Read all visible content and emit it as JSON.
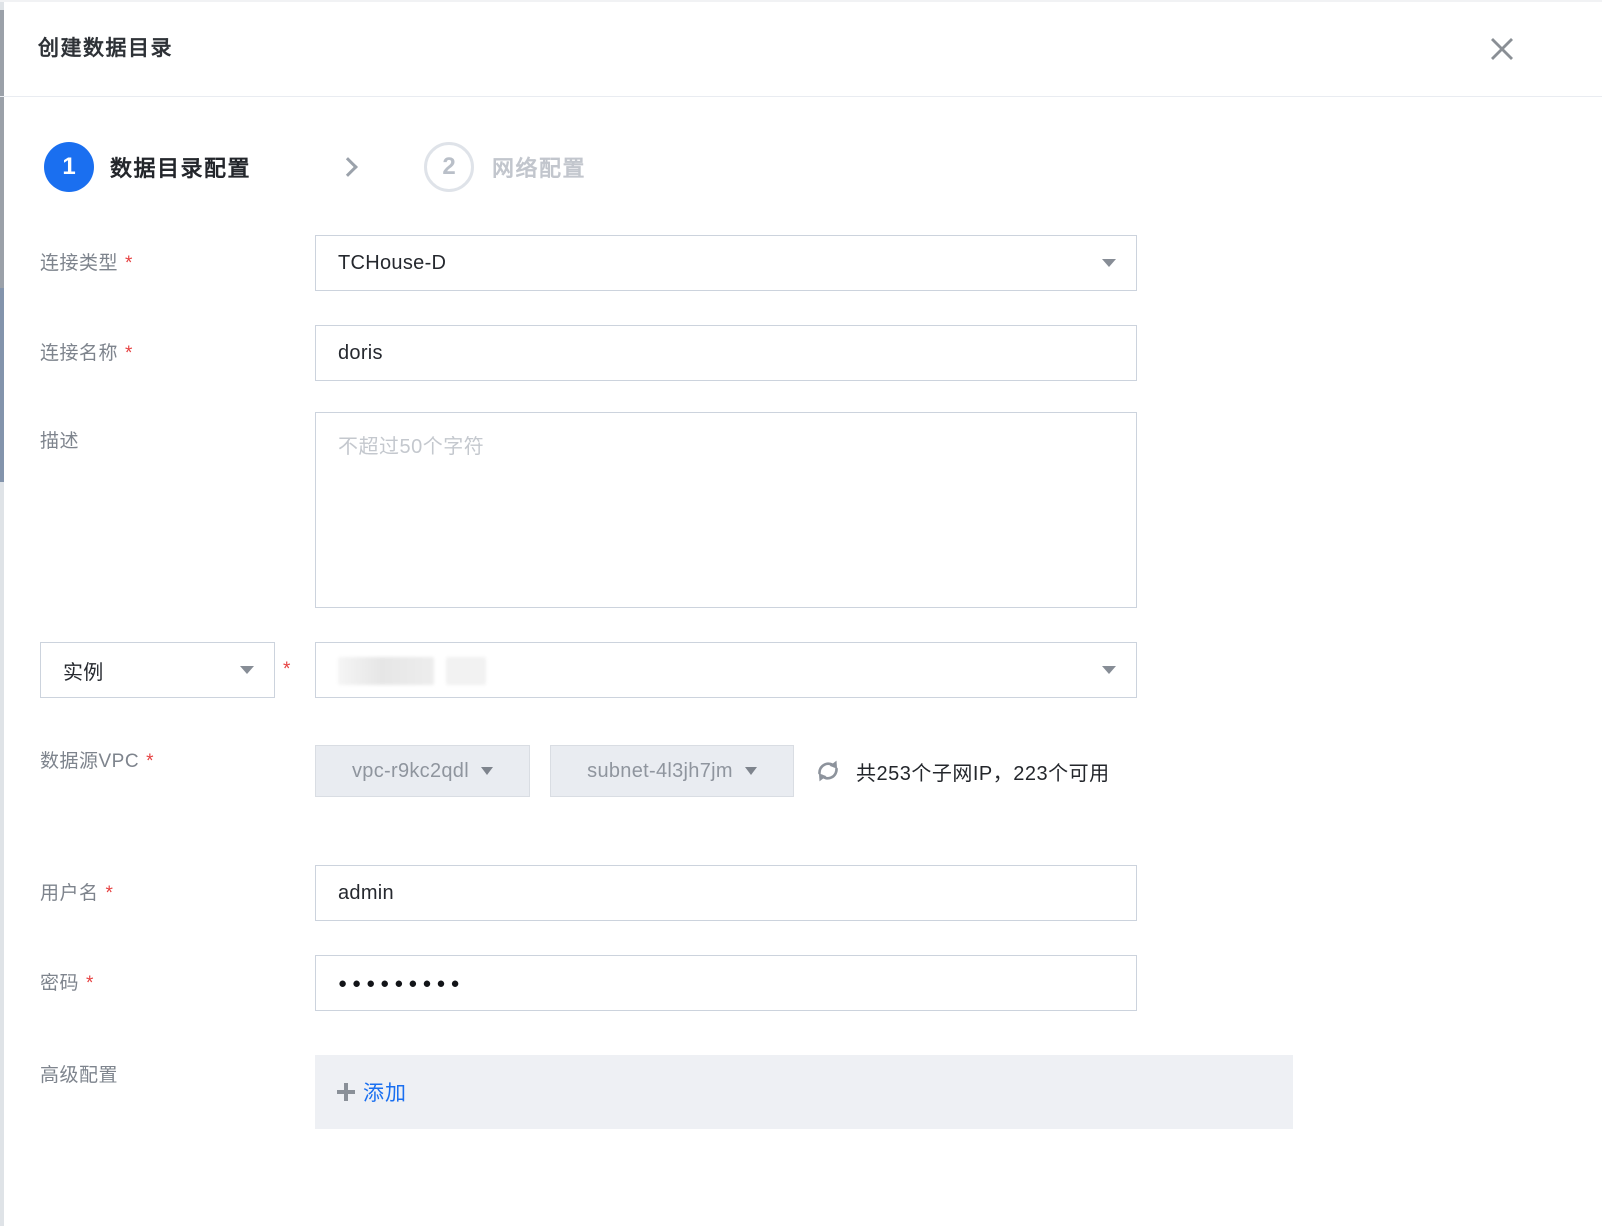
{
  "ui": {
    "required_marker": "*"
  },
  "header": {
    "title": "创建数据目录"
  },
  "stepper": {
    "step1": {
      "number": "1",
      "label": "数据目录配置"
    },
    "step2": {
      "number": "2",
      "label": "网络配置"
    }
  },
  "form": {
    "connection_type": {
      "label": "连接类型",
      "value": "TCHouse-D"
    },
    "connection_name": {
      "label": "连接名称",
      "value": "doris"
    },
    "description": {
      "label": "描述",
      "placeholder": "不超过50个字符",
      "value": ""
    },
    "instance": {
      "selector_value": "实例"
    },
    "vpc": {
      "label": "数据源VPC",
      "vpc_value": "vpc-r9kc2qdl",
      "subnet_value": "subnet-4l3jh7jm",
      "ip_summary": "共253个子网IP，223个可用"
    },
    "username": {
      "label": "用户名",
      "value": "admin"
    },
    "password": {
      "label": "密码",
      "masked_value": "●●●●●●●●●"
    },
    "advanced": {
      "label": "高级配置",
      "add_label": "添加"
    }
  },
  "colors": {
    "accent_blue": "#1a6ff0",
    "required_red": "#e64242",
    "disabled_bg": "#e9ecf1",
    "panel_bg": "#eef0f4"
  }
}
